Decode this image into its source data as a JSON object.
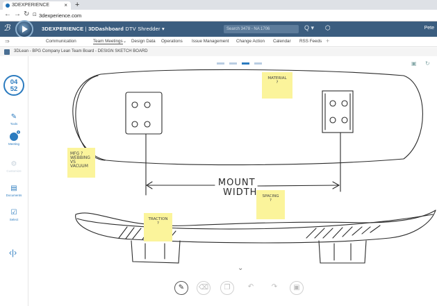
{
  "browser": {
    "tab_title": "3DEXPERIENCE",
    "tab_close": "×",
    "new_tab": "+",
    "url": "3dexperience.com",
    "back_icon": "arrow-left",
    "forward_icon": "arrow-right",
    "reload_icon": "reload"
  },
  "topbar": {
    "brand": "3DEXPERIENCE",
    "separator": " | ",
    "app": "3DDashboard",
    "dashboard": "DTV Shredder",
    "dropdown_glyph": "▾",
    "search_placeholder": "Search 3478 - NA 1706",
    "search_glyph": "Q",
    "user": "Pete"
  },
  "menu": {
    "items": [
      "Communication",
      "Team Meetings",
      "Design Data",
      "Operations",
      "Issue Management",
      "Change Action",
      "Calendar",
      "RSS Feeds"
    ],
    "active_index": 1,
    "add_glyph": "+"
  },
  "board": {
    "title": "3DLean - BPG Company Lean Team Board - DESIGN SKETCH BOARD"
  },
  "sidebar": {
    "timer": [
      "04",
      "52"
    ],
    "items": [
      "Tools",
      "Meeting",
      "Customize",
      "Documents",
      "Select"
    ],
    "meeting_badge": "1"
  },
  "canvas": {
    "page_dots": 4,
    "active_dot": 2,
    "stickies": {
      "material": [
        "MATERIAL",
        "?"
      ],
      "mfg": [
        "MFG ?",
        "WEBBING",
        "VS",
        "VACUUM"
      ],
      "spacing": [
        "SPACING",
        "?"
      ],
      "traction": [
        "TRACTION",
        "?"
      ]
    },
    "handwriting": [
      "MOUNT",
      "WIDTH"
    ]
  },
  "toolbar": {
    "tools": [
      "pen",
      "eraser",
      "sticky-note",
      "undo",
      "redo",
      "image"
    ],
    "active_tool": "pen"
  },
  "colors": {
    "topbar": "#3b5d7f",
    "accent": "#2b7bbf",
    "sticky": "#fbf49b"
  }
}
